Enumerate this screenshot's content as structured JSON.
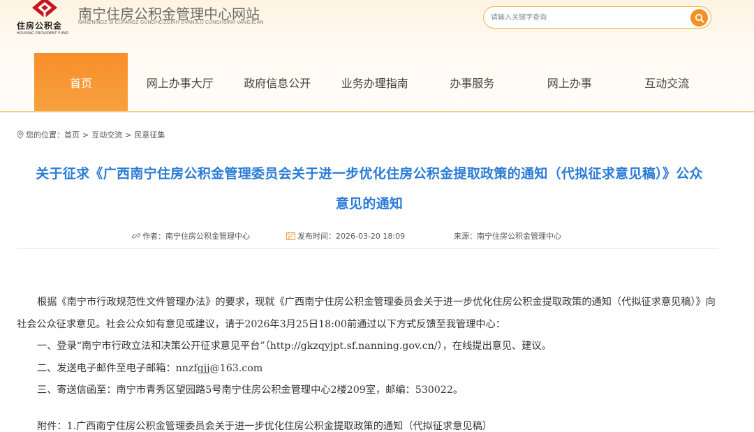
{
  "header": {
    "logo_cn": "住房公积金",
    "logo_en": "HOUSING PROVIDENT FUND",
    "site_title": "南宁住房公积金管理中心网站",
    "site_subtitle": "NANZNINGZ SI CUFANGZ GUNGHCIZGINH GVANJLIJ CUNGHSINH VANGJCAN",
    "search_placeholder": "请输入关键字查询",
    "search_icon": "search-icon"
  },
  "nav": {
    "items": [
      "首页",
      "网上办事大厅",
      "政府信息公开",
      "业务办理指南",
      "办事服务",
      "网上办事",
      "互动交流"
    ],
    "active_index": 0
  },
  "breadcrumb": {
    "label": "您的位置：",
    "items": [
      "首页",
      "互动交流",
      "民意征集"
    ],
    "separator": ">"
  },
  "article": {
    "title_line1": "关于征求《广西南宁住房公积金管理委员会关于进一步优化住房公积金提取政策的通知（代拟征求意见稿）》公众",
    "title_line2": "意见的通知",
    "author": "作者：南宁住房公积金管理中心",
    "published": "发布时间：2026-03-20 18:09",
    "source": "来源：南宁住房公积金管理中心",
    "paragraphs": [
      "根据《南宁市行政规范性文件管理办法》的要求，现就《广西南宁住房公积金管理委员会关于进一步优化住房公积金提取政策的通知（代拟征求意见稿）》向社会公众征求意见。社会公众如有意见或建议，请于2026年3月25日18:00前通过以下方式反馈至我管理中心：",
      "一、登录“南宁市行政立法和决策公开征求意见平台”（http://gkzqyjpt.sf.nanning.gov.cn/），在线提出意见、建议。",
      "二、发送电子邮件至电子邮箱：nnzfgjj@163.com",
      "三、寄送信函至：南宁市青秀区望园路5号南宁住房公积金管理中心2楼209室，邮编：530022。",
      "附件：1.广西南宁住房公积金管理委员会关于进一步优化住房公积金提取政策的通知（代拟征求意见稿）"
    ]
  },
  "colors": {
    "accent": "#f6932c",
    "title_blue": "#2a7bd5",
    "brand_red": "#c8161e"
  }
}
